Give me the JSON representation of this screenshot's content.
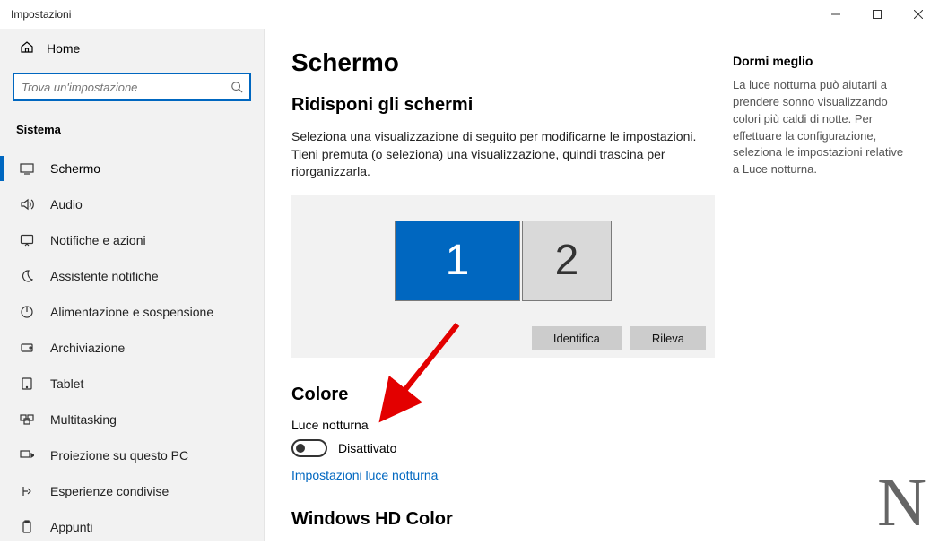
{
  "window": {
    "title": "Impostazioni"
  },
  "sidebar": {
    "home": "Home",
    "search_placeholder": "Trova un'impostazione",
    "category": "Sistema",
    "items": [
      {
        "label": "Schermo"
      },
      {
        "label": "Audio"
      },
      {
        "label": "Notifiche e azioni"
      },
      {
        "label": "Assistente notifiche"
      },
      {
        "label": "Alimentazione e sospensione"
      },
      {
        "label": "Archiviazione"
      },
      {
        "label": "Tablet"
      },
      {
        "label": "Multitasking"
      },
      {
        "label": "Proiezione su questo PC"
      },
      {
        "label": "Esperienze condivise"
      },
      {
        "label": "Appunti"
      }
    ]
  },
  "page": {
    "title": "Schermo",
    "rearrange_heading": "Ridisponi gli schermi",
    "rearrange_desc": "Seleziona una visualizzazione di seguito per modificarne le impostazioni. Tieni premuta (o seleziona) una visualizzazione, quindi trascina per riorganizzarla.",
    "monitor1": "1",
    "monitor2": "2",
    "identify": "Identifica",
    "detect": "Rileva",
    "color_heading": "Colore",
    "nightlight_label": "Luce notturna",
    "nightlight_state": "Disattivato",
    "nightlight_link": "Impostazioni luce notturna",
    "hdcolor_heading": "Windows HD Color"
  },
  "aside": {
    "title": "Dormi meglio",
    "body": "La luce notturna può aiutarti a prendere sonno visualizzando colori più caldi di notte. Per effettuare la configurazione, seleziona le impostazioni relative a Luce notturna."
  },
  "watermark": "N"
}
